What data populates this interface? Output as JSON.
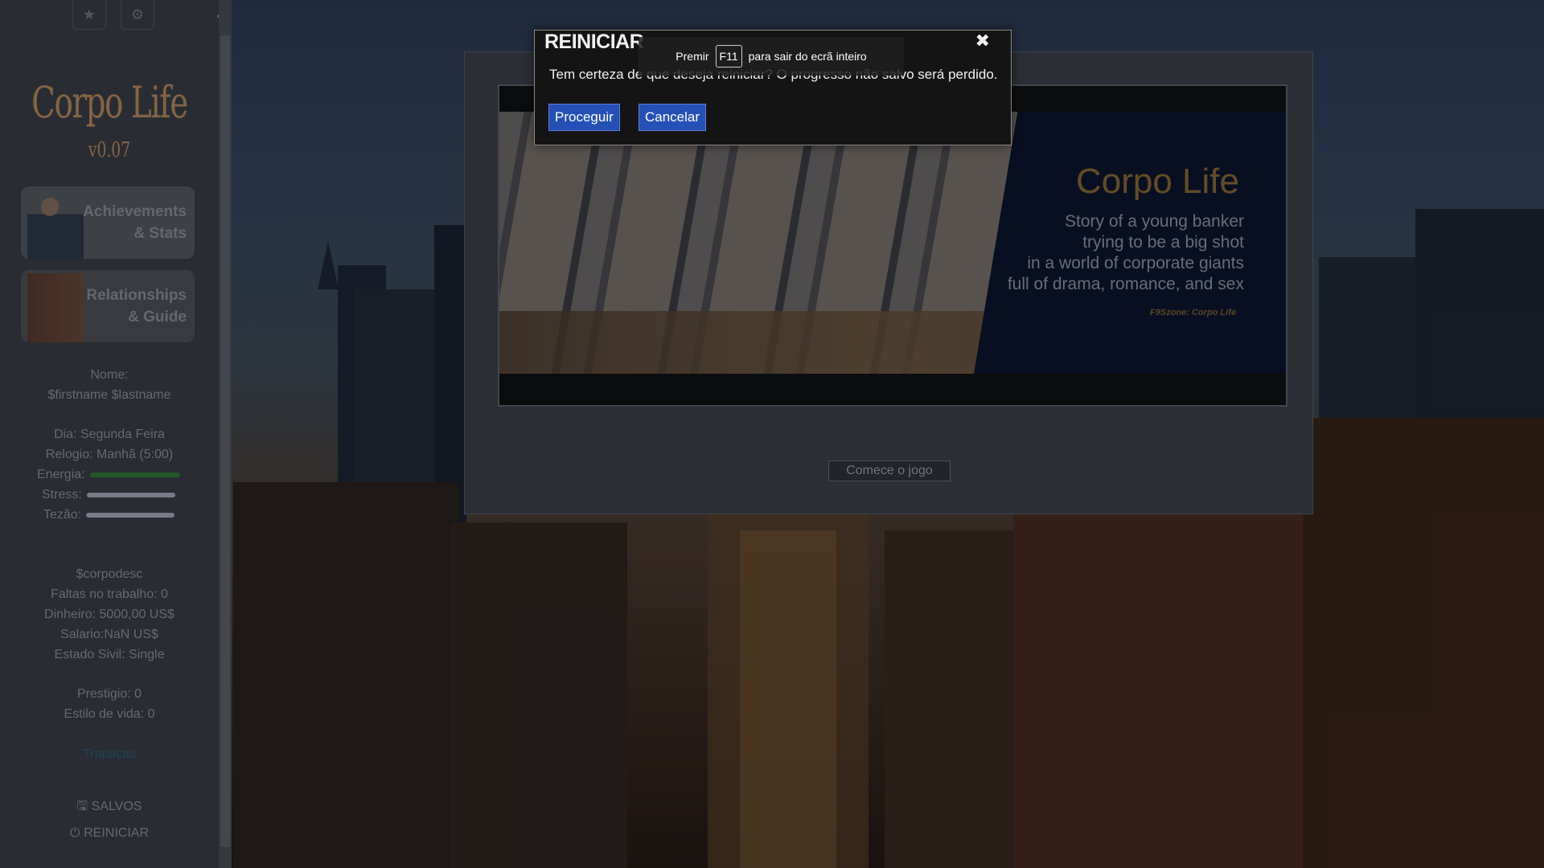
{
  "sidebar": {
    "collapse_icon": "chevron-left-icon",
    "logo_title": "Corpo Life",
    "logo_version": "v0.07",
    "nav_achievements": "Achievements\n& Stats",
    "nav_relationships": "Relationships\n& Guide",
    "name_label": "Nome:",
    "name_value": "$firstname $lastname",
    "day": "Dia: Segunda Feira",
    "clock": "Relogio: Manhã (5:00)",
    "energy_label": "Energia:",
    "stress_label": "Stress:",
    "tezao_label": "Tezão:",
    "energy_level": 1.0,
    "stress_level": 1.0,
    "tezao_level": 1.0,
    "corpodesc": "$corpodesc",
    "absences": "Faltas no trabalho: 0",
    "money": "Dinheiro: 5000,00 US$",
    "salary": "Salario:NaN US$",
    "civil_status": "Estado Sivil: Single",
    "prestige": "Prestigio: 0",
    "lifestyle": "Estilo de vida: 0",
    "link": "Trapaças",
    "saves": "SALVOS",
    "restart": "REINICIAR",
    "link_color": "#2a6a8a",
    "energy_color": "#2f7a38"
  },
  "main": {
    "banner_title": "Corpo Life",
    "banner_sub_1": "Story of a young banker",
    "banner_sub_2": "trying to be a big shot",
    "banner_sub_3": "in a world of corporate giants",
    "banner_sub_4": "full of drama, romance, and sex",
    "banner_credit": "F9Szone: Corpo Life",
    "start_button": "Comece o jogo"
  },
  "dialog": {
    "title": "REINICIAR",
    "close_icon": "close-icon",
    "message": "Tem certeza de que deseja reiniciar? O progresso não salvo será perdido.",
    "proceed": "Proceguir",
    "cancel": "Cancelar",
    "accent": "#2550b6"
  },
  "fullscreen_toast": {
    "prefix": "Premir",
    "key": "F11",
    "suffix": "para sair do ecrã inteiro"
  }
}
